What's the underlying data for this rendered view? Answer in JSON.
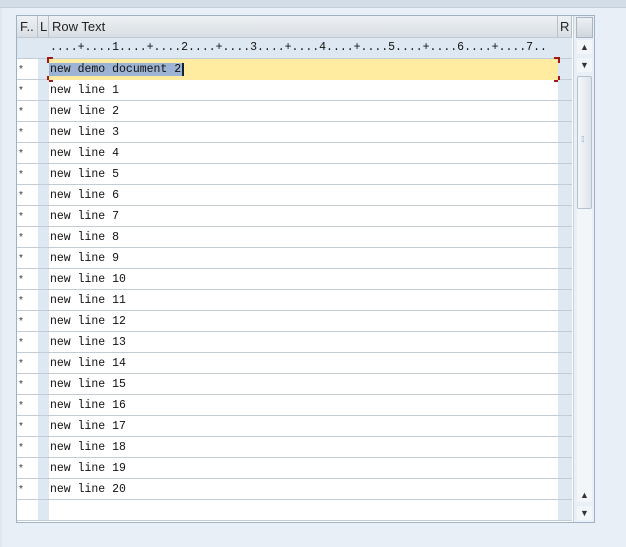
{
  "table": {
    "columns": [
      "F..",
      "L",
      "Row Text",
      "R"
    ],
    "ruler": "....+....1....+....2....+....3....+....4....+....5....+....6....+....7..",
    "rows": [
      {
        "flag": "*",
        "text": "new demo document 2",
        "selected": true
      },
      {
        "flag": "*",
        "text": "new line 1"
      },
      {
        "flag": "*",
        "text": "new line 2"
      },
      {
        "flag": "*",
        "text": "new line 3"
      },
      {
        "flag": "*",
        "text": "new line 4"
      },
      {
        "flag": "*",
        "text": "new line 5"
      },
      {
        "flag": "*",
        "text": "new line 6"
      },
      {
        "flag": "*",
        "text": "new line 7"
      },
      {
        "flag": "*",
        "text": "new line 8"
      },
      {
        "flag": "*",
        "text": "new line 9"
      },
      {
        "flag": "*",
        "text": "new line 10"
      },
      {
        "flag": "*",
        "text": "new line 11"
      },
      {
        "flag": "*",
        "text": "new line 12"
      },
      {
        "flag": "*",
        "text": "new line 13"
      },
      {
        "flag": "*",
        "text": "new line 14"
      },
      {
        "flag": "*",
        "text": "new line 15"
      },
      {
        "flag": "*",
        "text": "new line 16"
      },
      {
        "flag": "*",
        "text": "new line 17"
      },
      {
        "flag": "*",
        "text": "new line 18"
      },
      {
        "flag": "*",
        "text": "new line 19"
      },
      {
        "flag": "*",
        "text": "new line 20"
      },
      {
        "flag": "",
        "text": ""
      }
    ]
  },
  "icons": {
    "up": "arrow-up-icon",
    "down": "arrow-down-icon",
    "grip": "grip-icon"
  },
  "colors": {
    "selected_row": "#ffeca0",
    "selection": "#9db3d3",
    "column_shade": "#dde8f3"
  }
}
